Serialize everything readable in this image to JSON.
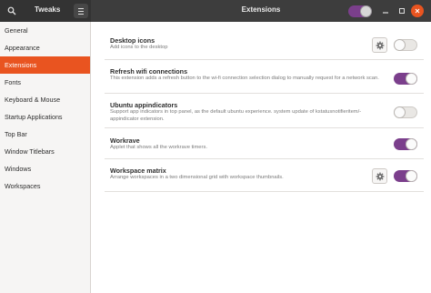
{
  "header": {
    "app_title": "Tweaks",
    "page_title": "Extensions",
    "global_extensions_enabled": true
  },
  "sidebar": {
    "items": [
      {
        "label": "General",
        "active": false
      },
      {
        "label": "Appearance",
        "active": false
      },
      {
        "label": "Extensions",
        "active": true
      },
      {
        "label": "Fonts",
        "active": false
      },
      {
        "label": "Keyboard & Mouse",
        "active": false
      },
      {
        "label": "Startup Applications",
        "active": false
      },
      {
        "label": "Top Bar",
        "active": false
      },
      {
        "label": "Window Titlebars",
        "active": false
      },
      {
        "label": "Windows",
        "active": false
      },
      {
        "label": "Workspaces",
        "active": false
      }
    ]
  },
  "extensions": [
    {
      "title": "Desktop icons",
      "description": "Add icons to the desktop",
      "has_settings": true,
      "enabled": false
    },
    {
      "title": "Refresh wifi connections",
      "description": "This extension adds a refresh button to the wi-fi connection selection dialog to manually request for a network scan.",
      "has_settings": false,
      "enabled": true
    },
    {
      "title": "Ubuntu appindicators",
      "description": "Support app indicators in top panel, as the default ubuntu experience. system update of kstatusnotifieritem/-appindicator extension.",
      "has_settings": false,
      "enabled": false
    },
    {
      "title": "Workrave",
      "description": "Applet that shows all the workrave timers.",
      "has_settings": false,
      "enabled": true
    },
    {
      "title": "Workspace matrix",
      "description": "Arrange workspaces in a two dimensional grid with workspace thumbnails.",
      "has_settings": true,
      "enabled": true
    }
  ],
  "colors": {
    "accent": "#e95420",
    "switch_on": "#7b3f8c",
    "headerbar": "#3d3d3d"
  }
}
